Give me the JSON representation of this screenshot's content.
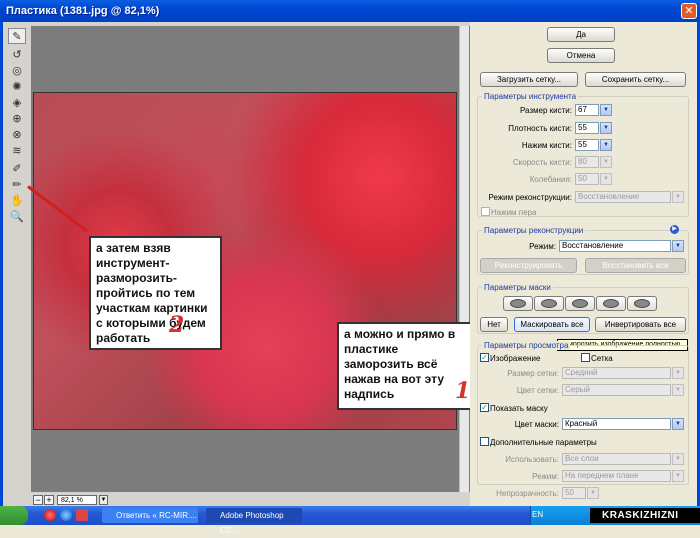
{
  "window": {
    "title": "Пластика (1381.jpg @ 82,1%)",
    "close_glyph": "✕"
  },
  "buttons": {
    "ok": "Да",
    "cancel": "Отмена",
    "load_mesh": "Загрузить сетку...",
    "save_mesh": "Сохранить сетку..."
  },
  "tool_options": {
    "title": "Параметры инструмента",
    "brush_size": {
      "label": "Размер кисти:",
      "value": "67"
    },
    "brush_density": {
      "label": "Плотность кисти:",
      "value": "55"
    },
    "brush_pressure": {
      "label": "Нажим кисти:",
      "value": "55"
    },
    "brush_rate": {
      "label": "Скорость кисти:",
      "value": "80"
    },
    "turbulence": {
      "label": "Колебания:",
      "value": "50"
    },
    "recon_mode": {
      "label": "Режим реконструкции:",
      "value": "Восстановление"
    },
    "stylus": "Нажим пера"
  },
  "recon_options": {
    "title": "Параметры реконструкции",
    "mode_label": "Режим:",
    "mode_value": "Восстановление",
    "reconstruct": "Реконструировать",
    "restore_all": "Восстановить все"
  },
  "mask_options": {
    "title": "Параметры маски",
    "none": "Нет",
    "mask_all": "Маскировать все",
    "invert_all": "Инвертировать все",
    "tooltip": "Заморозить изображение полностью"
  },
  "view_options": {
    "title": "Параметры просмотра",
    "show_image": "Изображение",
    "show_mesh": "Сетка",
    "mesh_size_label": "Размер сетки:",
    "mesh_size_value": "Средний",
    "mesh_color_label": "Цвет сетки:",
    "mesh_color_value": "Серый",
    "show_mask": "Показать маску",
    "mask_color_label": "Цвет маски:",
    "mask_color_value": "Красный",
    "extra": "Дополнительные параметры",
    "use_label": "Использовать:",
    "use_value": "Все слои",
    "mode_label": "Режим:",
    "mode_value": "На переднем плане",
    "opacity_label": "Непрозрачность:",
    "opacity_value": "50"
  },
  "annotations": {
    "callout1": "а можно и прямо в пластике заморозить всё нажав на вот эту надпись",
    "callout1_num": "1",
    "callout2": "а затем взяв инструмент-разморозить- пройтись по тем участкам картинки с которыми будем работать",
    "callout2_num": "2",
    "accent_color": "#d8302a"
  },
  "zoom": {
    "minus": "−",
    "plus": "+",
    "value": "82,1 %"
  },
  "taskbar": {
    "task1": "Ответить « RC-MIR....",
    "task2": "Adobe Photoshop CS...",
    "lang": "EN",
    "brand": "KRASKIZHIZNI"
  }
}
